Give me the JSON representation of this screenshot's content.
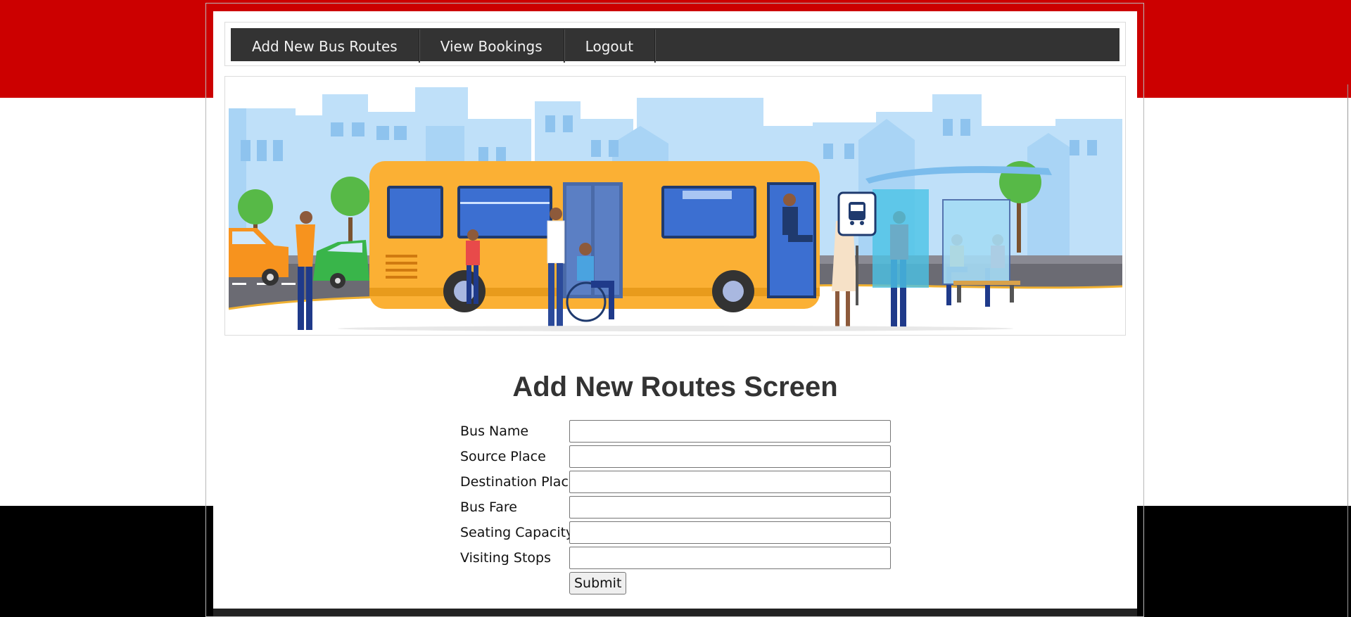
{
  "nav": {
    "items": [
      {
        "label": "Add New Bus Routes"
      },
      {
        "label": "View Bookings"
      },
      {
        "label": "Logout"
      }
    ]
  },
  "banner": {
    "image": "bus-stop-illustration",
    "sign_icon": "bus-icon"
  },
  "page_title": "Add New Routes Screen",
  "form": {
    "fields": [
      {
        "label": "Bus Name",
        "value": ""
      },
      {
        "label": "Source Place",
        "value": ""
      },
      {
        "label": "Destination Place",
        "value": ""
      },
      {
        "label": "Bus Fare",
        "value": ""
      },
      {
        "label": "Seating Capacity",
        "value": ""
      },
      {
        "label": "Visiting Stops",
        "value": ""
      }
    ],
    "submit_label": "Submit"
  },
  "colors": {
    "top_band": "#cc0000",
    "bottom_band": "#000000",
    "nav_bg": "#333333",
    "nav_text": "#f2f2f2",
    "title": "#333333",
    "bus": "#fbb034"
  }
}
